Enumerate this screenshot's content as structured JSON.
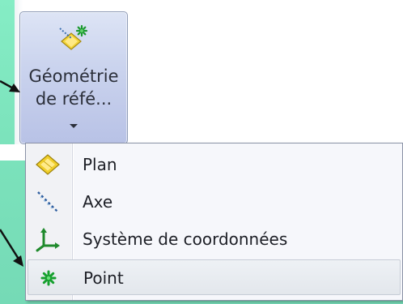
{
  "ribbon": {
    "button": {
      "label_line1": "Géométrie",
      "label_line2": "de réfé...",
      "icon": "reference-geometry-icon",
      "dropdown_icon": "dropdown-arrow-icon"
    }
  },
  "menu": {
    "items": [
      {
        "label": "Plan",
        "icon": "plane-icon"
      },
      {
        "label": "Axe",
        "icon": "axis-icon"
      },
      {
        "label": "Système de coordonnées",
        "icon": "coordinate-system-icon"
      },
      {
        "label": "Point",
        "icon": "point-icon",
        "highlighted": true
      }
    ]
  },
  "colors": {
    "background": "#7fe6bf",
    "button_fill": "#c8d1ee",
    "menu_bg": "#f6f7fb",
    "arrow": "#111111"
  }
}
